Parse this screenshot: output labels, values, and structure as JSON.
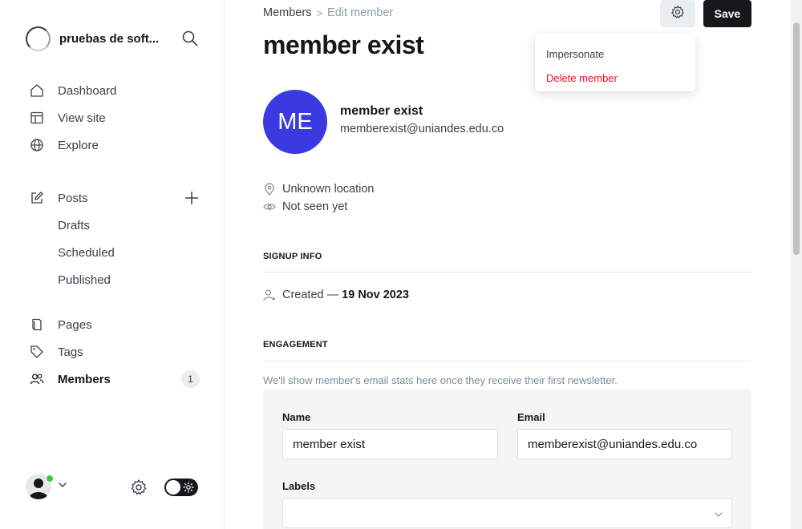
{
  "sidebar": {
    "site_title": "pruebas de soft...",
    "nav": [
      {
        "label": "Dashboard",
        "icon": "house-icon"
      },
      {
        "label": "View site",
        "icon": "layout-icon"
      },
      {
        "label": "Explore",
        "icon": "globe-icon"
      }
    ],
    "posts": {
      "label": "Posts",
      "icon": "pencil-square-icon"
    },
    "post_subitems": [
      "Drafts",
      "Scheduled",
      "Published"
    ],
    "nav2": [
      {
        "label": "Pages",
        "icon": "page-icon"
      },
      {
        "label": "Tags",
        "icon": "tag-icon"
      },
      {
        "label": "Members",
        "icon": "users-icon"
      }
    ],
    "members_count": "1"
  },
  "header": {
    "breadcrumb_parent": "Members",
    "breadcrumb_sep": ">",
    "breadcrumb_current": "Edit member",
    "title": "member exist",
    "save_label": "Save"
  },
  "dropdown": {
    "impersonate": "Impersonate",
    "delete": "Delete member"
  },
  "member": {
    "initials": "ME",
    "name": "member exist",
    "email": "memberexist@uniandes.edu.co",
    "location": "Unknown location",
    "seen": "Not seen yet"
  },
  "signup": {
    "section_title": "SIGNUP INFO",
    "created_prefix": "Created —",
    "created_date": "19 Nov 2023"
  },
  "engagement": {
    "section_title": "ENGAGEMENT",
    "text": "We'll show member's email stats here once they receive their first newsletter."
  },
  "form": {
    "name_label": "Name",
    "name_value": "member exist",
    "email_label": "Email",
    "email_value": "memberexist@uniandes.edu.co",
    "labels_label": "Labels",
    "labels_value": ""
  },
  "colors": {
    "accent_avatar": "#3a3ae0",
    "delete_red": "#f50b23",
    "online_green": "#30cf43"
  }
}
